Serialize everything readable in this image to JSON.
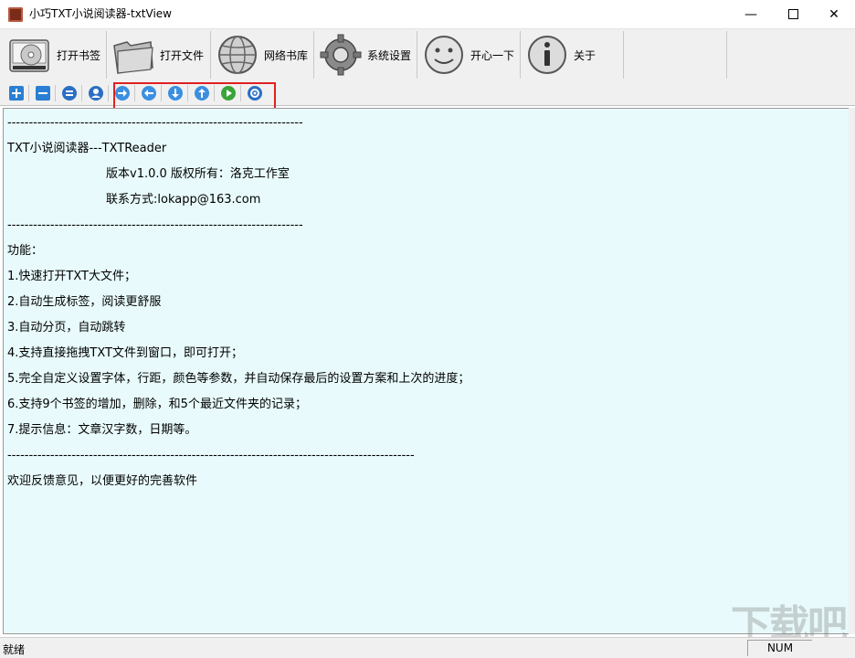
{
  "window": {
    "title": "小巧TXT小说阅读器-txtView",
    "controls": {
      "minimize": "—",
      "close": "✕"
    }
  },
  "toolbar": {
    "buttons": [
      {
        "label": "打开书签",
        "icon": "bookmark-disk-icon"
      },
      {
        "label": "打开文件",
        "icon": "folder-icon"
      },
      {
        "label": "网络书库",
        "icon": "globe-icon"
      },
      {
        "label": "系统设置",
        "icon": "gear-icon"
      },
      {
        "label": "开心一下",
        "icon": "smiley-icon"
      },
      {
        "label": "关于",
        "icon": "info-icon"
      }
    ]
  },
  "small_toolbar": {
    "buttons": [
      {
        "name": "zoom-in-icon",
        "glyph": "+"
      },
      {
        "name": "zoom-out-icon",
        "glyph": "−"
      },
      {
        "name": "line-spacing-icon",
        "glyph": "⊖"
      },
      {
        "name": "user-icon",
        "glyph": "●"
      },
      {
        "name": "next-page-icon",
        "glyph": "→"
      },
      {
        "name": "prev-page-icon",
        "glyph": "←"
      },
      {
        "name": "scroll-down-icon",
        "glyph": "↓"
      },
      {
        "name": "scroll-up-icon",
        "glyph": "↑"
      },
      {
        "name": "auto-scroll-icon",
        "glyph": "▶"
      },
      {
        "name": "refresh-icon",
        "glyph": "↻"
      }
    ]
  },
  "content": {
    "lines": [
      "---------------------------------------------------------------------",
      "TXT小说阅读器---TXTReader",
      "版本v1.0.0 版权所有：洛克工作室",
      "联系方式:lokapp@163.com",
      "---------------------------------------------------------------------",
      "功能：",
      "1.快速打开TXT大文件；",
      "2.自动生成标签，阅读更舒服",
      "3.自动分页，自动跳转",
      "4.支持直接拖拽TXT文件到窗口，即可打开；",
      "5.完全自定义设置字体，行距，颜色等参数，并自动保存最后的设置方案和上次的进度；",
      "6.支持9个书签的增加，删除，和5个最近文件夹的记录；",
      "7.提示信息：文章汉字数，日期等。",
      "-----------------------------------------------------------------------------------------------",
      "欢迎反馈意见，以便更好的完善软件"
    ]
  },
  "status": {
    "left": "就绪",
    "num": "NUM"
  },
  "watermark": "下载吧",
  "colors": {
    "content_bg": "#e8fafb",
    "highlight": "#e02020",
    "accent_blue": "#2a7fd4"
  }
}
